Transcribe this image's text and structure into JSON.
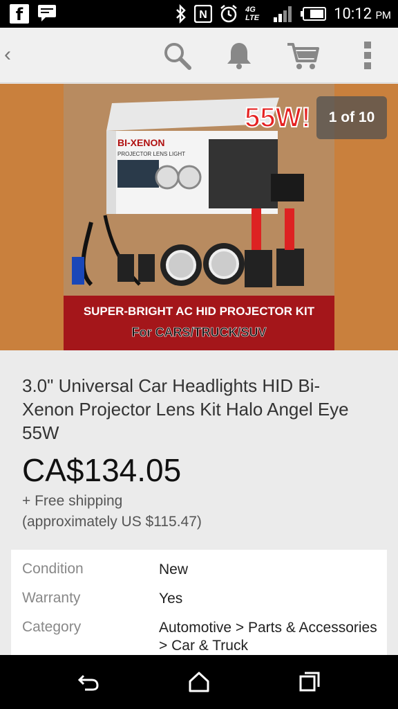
{
  "status_bar": {
    "time": "10:12",
    "ampm": "PM",
    "network": "4G LTE",
    "icons": [
      "facebook-icon",
      "message-icon",
      "bluetooth-icon",
      "nfc-icon",
      "alarm-icon",
      "signal-icon",
      "battery-icon"
    ]
  },
  "app_bar": {
    "back_glyph": "‹",
    "icons": [
      "search-icon",
      "notifications-icon",
      "cart-icon",
      "overflow-menu-icon"
    ]
  },
  "hero": {
    "counter": "1 of 10",
    "image_texts": {
      "brand": "BI-XENON",
      "sub": "PROJECTOR LENS LIGHT",
      "watt": "55W!",
      "banner_top": "SUPER-BRIGHT AC HID PROJECTOR KIT",
      "banner_bottom": "For CARS/TRUCK/SUV"
    }
  },
  "listing": {
    "title": "3.0\" Universal Car Headlights HID Bi-Xenon Projector Lens Kit Halo Angel Eye 55W",
    "price": "CA$134.05",
    "shipping": "+ Free shipping",
    "approx": "(approximately US $115.47)"
  },
  "details": [
    {
      "label": "Condition",
      "value": "New"
    },
    {
      "label": "Warranty",
      "value": "Yes"
    },
    {
      "label": "Category",
      "value": "Automotive > Parts & Accessories > Car & Truck"
    }
  ],
  "colors": {
    "hero_bg": "#c9803d",
    "banner_red": "#a4161a",
    "price": "#111111"
  }
}
